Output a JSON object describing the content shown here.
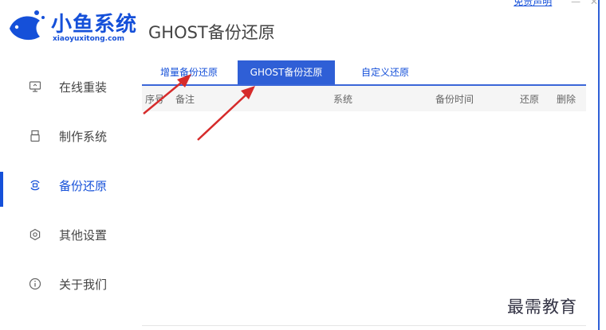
{
  "app": {
    "logo_name": "小鱼系统",
    "logo_url": "xiaoyuxitong.com",
    "page_title": "GHOST备份还原",
    "disclaimer": "免责声明",
    "minimize": "—",
    "close": "✕"
  },
  "sidebar": {
    "items": [
      {
        "label": "在线重装",
        "icon": "monitor-icon"
      },
      {
        "label": "制作系统",
        "icon": "usb-drive-icon"
      },
      {
        "label": "备份还原",
        "icon": "backup-icon",
        "active": true
      },
      {
        "label": "其他设置",
        "icon": "gear-icon"
      },
      {
        "label": "关于我们",
        "icon": "info-icon"
      }
    ]
  },
  "tabs": [
    {
      "label": "增量备份还原"
    },
    {
      "label": "GHOST备份还原",
      "active": true
    },
    {
      "label": "自定义还原"
    }
  ],
  "table": {
    "columns": [
      "序号",
      "备注",
      "系统",
      "备份时间",
      "还原",
      "删除"
    ]
  },
  "watermark": "最需教育",
  "colors": {
    "accent": "#1550d9",
    "tab_active": "#2f5fd6",
    "arrow": "#d62b2b"
  }
}
